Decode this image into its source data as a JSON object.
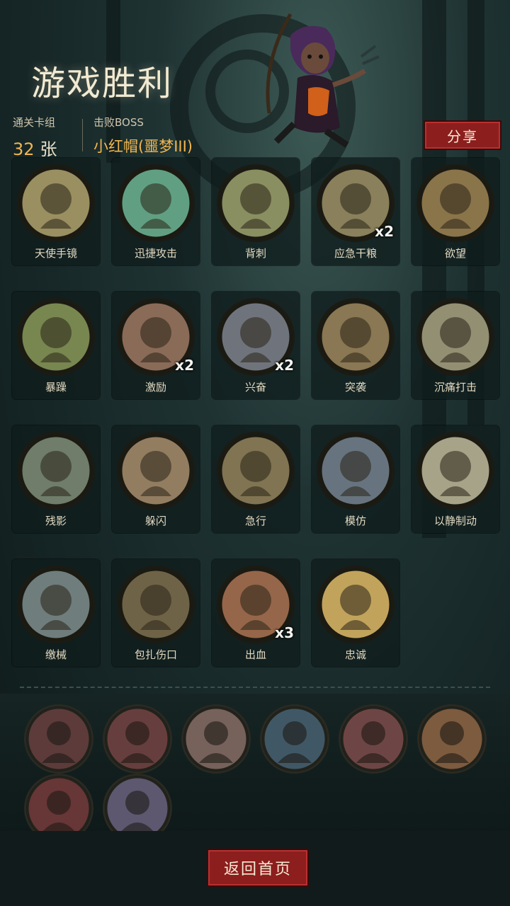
{
  "header": {
    "title": "游戏胜利",
    "cards_label": "通关卡组",
    "cards_count": "32",
    "cards_unit": "张",
    "boss_label": "击败BOSS",
    "boss_name": "小红帽(噩梦III)",
    "share_label": "分享"
  },
  "cards": [
    {
      "name": "天使手镜",
      "mult": "",
      "icon": "mirror-icon",
      "color": "#a89a6a"
    },
    {
      "name": "迅捷攻击",
      "mult": "",
      "icon": "swift-attack-icon",
      "color": "#3fb8a8"
    },
    {
      "name": "背刺",
      "mult": "",
      "icon": "backstab-icon",
      "color": "#8a9a6a"
    },
    {
      "name": "应急干粮",
      "mult": "x2",
      "icon": "rations-icon",
      "color": "#8a8060"
    },
    {
      "name": "欲望",
      "mult": "",
      "icon": "desire-icon",
      "color": "#8a6a40"
    },
    {
      "name": "暴躁",
      "mult": "",
      "icon": "rage-icon",
      "color": "#6a8a4a"
    },
    {
      "name": "激励",
      "mult": "x2",
      "icon": "inspire-icon",
      "color": "#8a5a5a"
    },
    {
      "name": "兴奋",
      "mult": "x2",
      "icon": "excite-icon",
      "color": "#5a6a9a"
    },
    {
      "name": "突袭",
      "mult": "",
      "icon": "raid-icon",
      "color": "#8a7050"
    },
    {
      "name": "沉痛打击",
      "mult": "",
      "icon": "heavy-strike-icon",
      "color": "#9a9a8a"
    },
    {
      "name": "残影",
      "mult": "",
      "icon": "afterimage-icon",
      "color": "#5a7a7a"
    },
    {
      "name": "躲闪",
      "mult": "",
      "icon": "dodge-icon",
      "color": "#9a7a6a"
    },
    {
      "name": "急行",
      "mult": "",
      "icon": "rush-icon",
      "color": "#7a6a50"
    },
    {
      "name": "模仿",
      "mult": "",
      "icon": "mimic-icon",
      "color": "#4a6aa0"
    },
    {
      "name": "以静制动",
      "mult": "",
      "icon": "skull-icon",
      "color": "#c0c0b0"
    },
    {
      "name": "缴械",
      "mult": "",
      "icon": "disarm-icon",
      "color": "#5a7a9a"
    },
    {
      "name": "包扎伤口",
      "mult": "",
      "icon": "bandage-icon",
      "color": "#5a4a3a"
    },
    {
      "name": "出血",
      "mult": "x3",
      "icon": "bleed-icon",
      "color": "#a05040"
    },
    {
      "name": "忠诚",
      "mult": "",
      "icon": "cross-icon",
      "color": "#f0c060"
    }
  ],
  "relics": [
    {
      "icon": "hooded-figure-icon",
      "color": "#8a2a2a"
    },
    {
      "icon": "card-stack-icon",
      "color": "#a03030"
    },
    {
      "icon": "hand-cards-icon",
      "color": "#c08070"
    },
    {
      "icon": "chest-icon",
      "color": "#4a6a8a"
    },
    {
      "icon": "red-hood-icon",
      "color": "#b04040"
    },
    {
      "icon": "pirate-icon",
      "color": "#d07030"
    },
    {
      "icon": "card-skull-icon",
      "color": "#a02020"
    },
    {
      "icon": "meditating-woman-icon",
      "color": "#8a6aa0"
    }
  ],
  "footer": {
    "home_label": "返回首页"
  }
}
